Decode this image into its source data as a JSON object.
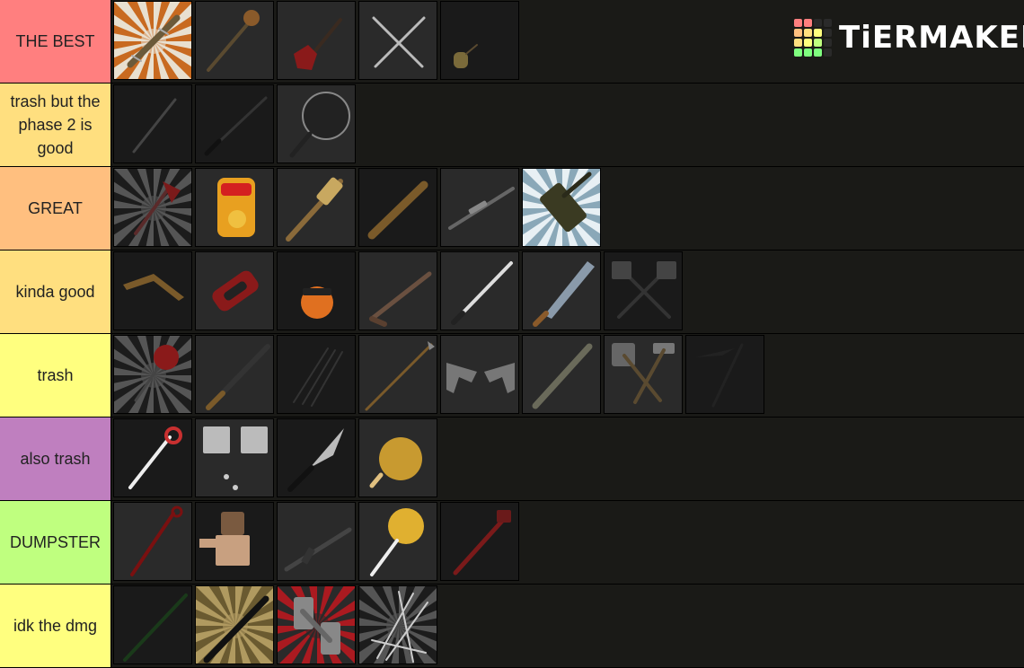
{
  "logo": {
    "text": "TiERMAKER",
    "grid_colors": [
      "#ff7f7f",
      "#ff7f7f",
      "#2a2a2a",
      "#2a2a2a",
      "#ffbf7f",
      "#ffdf7f",
      "#ffff7f",
      "#2a2a2a",
      "#ffdf7f",
      "#ffff7f",
      "#bfff7f",
      "#2a2a2a",
      "#7fff7f",
      "#7fff7f",
      "#7fff7f",
      "#2a2a2a"
    ]
  },
  "tiers": [
    {
      "label": "THE BEST",
      "color": "#ff7f7f",
      "items": [
        {
          "icon": "bat-with-nails-icon",
          "bg": "burst-orange"
        },
        {
          "icon": "spiked-mace-icon",
          "bg": "dark"
        },
        {
          "icon": "red-guitar-icon",
          "bg": "dark"
        },
        {
          "icon": "crossed-sabres-icon",
          "bg": "dark"
        },
        {
          "icon": "small-bottle-icon",
          "bg": "darker"
        }
      ]
    },
    {
      "label": "trash but the phase 2 is good",
      "color": "#ffdf7f",
      "items": [
        {
          "icon": "cane-icon",
          "bg": "darker"
        },
        {
          "icon": "katana-dark-icon",
          "bg": "darker"
        },
        {
          "icon": "frying-pan-icon",
          "bg": "dark"
        }
      ]
    },
    {
      "label": "GREAT",
      "color": "#ffbf7f",
      "items": [
        {
          "icon": "red-axe-icon",
          "bg": "burst-dark"
        },
        {
          "icon": "cheetos-bag-icon",
          "bg": "dark"
        },
        {
          "icon": "wrapped-bat-icon",
          "bg": "dark"
        },
        {
          "icon": "wooden-bat-icon",
          "bg": "darker"
        },
        {
          "icon": "sniper-rifle-icon",
          "bg": "dark"
        },
        {
          "icon": "minigun-icon",
          "bg": "burst-blue"
        }
      ]
    },
    {
      "label": "kinda good",
      "color": "#ffdf7f",
      "items": [
        {
          "icon": "boomerang-icon",
          "bg": "darker"
        },
        {
          "icon": "red-pillow-icon",
          "bg": "dark"
        },
        {
          "icon": "pumpkin-bucket-icon",
          "bg": "darker"
        },
        {
          "icon": "shotgun-icon",
          "bg": "dark"
        },
        {
          "icon": "white-katana-icon",
          "bg": "dark"
        },
        {
          "icon": "machete-icon",
          "bg": "dark"
        },
        {
          "icon": "crossed-axes-icon",
          "bg": "darker"
        }
      ]
    },
    {
      "label": "trash",
      "color": "#ffff7f",
      "items": [
        {
          "icon": "stop-sign-icon",
          "bg": "burst-dark"
        },
        {
          "icon": "long-sword-icon",
          "bg": "dark"
        },
        {
          "icon": "claws-icon",
          "bg": "darker"
        },
        {
          "icon": "spear-icon",
          "bg": "dark"
        },
        {
          "icon": "dual-pistols-icon",
          "bg": "dark"
        },
        {
          "icon": "pipe-icon",
          "bg": "dark"
        },
        {
          "icon": "shovel-hammer-icon",
          "bg": "dark"
        },
        {
          "icon": "scythe-icon",
          "bg": "darker"
        }
      ]
    },
    {
      "label": "also trash",
      "color": "#bf7fbf",
      "items": [
        {
          "icon": "candy-cane-icon",
          "bg": "darker"
        },
        {
          "icon": "cleavers-icon",
          "bg": "dark"
        },
        {
          "icon": "kitchen-knife-icon",
          "bg": "darker"
        },
        {
          "icon": "roast-chicken-icon",
          "bg": "dark"
        }
      ]
    },
    {
      "label": "DUMPSTER",
      "color": "#bfff7f",
      "items": [
        {
          "icon": "crowbar-icon",
          "bg": "dark"
        },
        {
          "icon": "roblox-character-icon",
          "bg": "darker"
        },
        {
          "icon": "smg-icon",
          "bg": "dark"
        },
        {
          "icon": "lollipop-icon",
          "bg": "dark"
        },
        {
          "icon": "pipe-wrench-icon",
          "bg": "darker"
        }
      ]
    },
    {
      "label": "idk the dmg",
      "color": "#ffff7f",
      "items": [
        {
          "icon": "dark-staff-icon",
          "bg": "darker"
        },
        {
          "icon": "baton-icon",
          "bg": "burst-olive"
        },
        {
          "icon": "dumbbells-icon",
          "bg": "burst-red"
        },
        {
          "icon": "multiple-swords-icon",
          "bg": "burst-dark"
        }
      ]
    }
  ]
}
